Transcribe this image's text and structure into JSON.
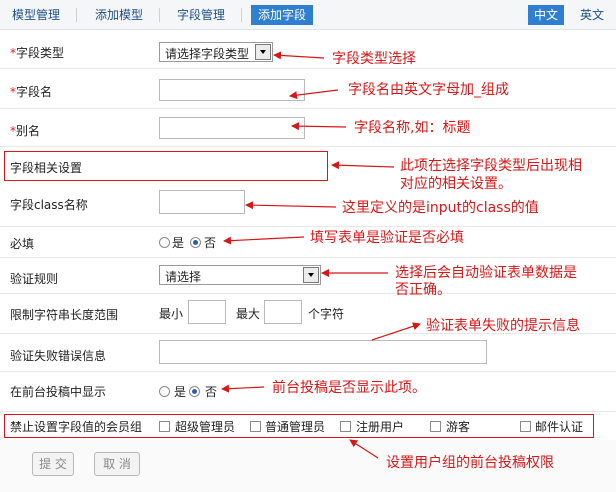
{
  "tabs": [
    {
      "label": "模型管理"
    },
    {
      "label": "添加模型"
    },
    {
      "label": "字段管理"
    },
    {
      "label": "添加字段"
    }
  ],
  "lang": {
    "zh": "中文",
    "en": "英文"
  },
  "fields": {
    "field_type": {
      "required": "*",
      "label": "字段类型",
      "select_value": "请选择字段类型"
    },
    "field_name": {
      "required": "*",
      "label": "字段名"
    },
    "alias": {
      "required": "*",
      "label": "别名"
    },
    "settings": {
      "label": "字段相关设置"
    },
    "css_class": {
      "label": "字段class名称"
    },
    "required": {
      "label": "必填",
      "yes": "是",
      "no": "否"
    },
    "validation": {
      "label": "验证规则",
      "select_value": "请选择"
    },
    "length_range": {
      "label": "限制字符串长度范围",
      "min": "最小",
      "max": "最大",
      "unit": "个字符"
    },
    "error_msg": {
      "label": "验证失败错误信息"
    },
    "front_show": {
      "label": "在前台投稿中显示",
      "yes": "是",
      "no": "否"
    },
    "groups": {
      "label": "禁止设置字段值的会员组",
      "options": [
        "超级管理员",
        "普通管理员",
        "注册用户",
        "游客",
        "邮件认证"
      ]
    }
  },
  "buttons": {
    "submit": "提 交",
    "cancel": "取 消"
  },
  "notes": {
    "field_type": "字段类型选择",
    "field_name": "字段名由英文字母加_组成",
    "alias": "字段名称,如：标题",
    "settings_line1": "此项在选择字段类型后出现相",
    "settings_line2": "对应的相关设置。",
    "css_class": "这里定义的是input的class的值",
    "required": "填写表单是验证是否必填",
    "validation_line1": "选择后会自动验证表单数据是",
    "validation_line2": "否正确。",
    "error_msg": "验证表单失败的提示信息",
    "front_show": "前台投稿是否显示此项。",
    "groups": "设置用户组的前台投稿权限"
  },
  "colors": {
    "accent": "#2f7fd0",
    "annotation": "#d81818",
    "required": "#e02020"
  }
}
